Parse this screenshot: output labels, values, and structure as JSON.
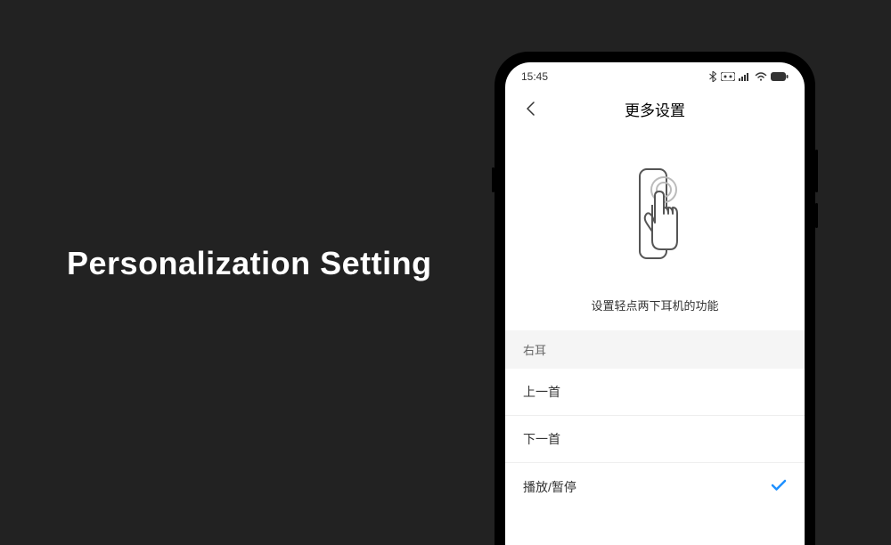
{
  "marketing": {
    "headline": "Personalization Setting"
  },
  "statusBar": {
    "time": "15:45"
  },
  "header": {
    "title": "更多设置"
  },
  "instruction": {
    "text": "设置轻点两下耳机的功能"
  },
  "section": {
    "label": "右耳"
  },
  "options": [
    {
      "label": "上一首",
      "selected": false
    },
    {
      "label": "下一首",
      "selected": false
    },
    {
      "label": "播放/暂停",
      "selected": true
    }
  ]
}
